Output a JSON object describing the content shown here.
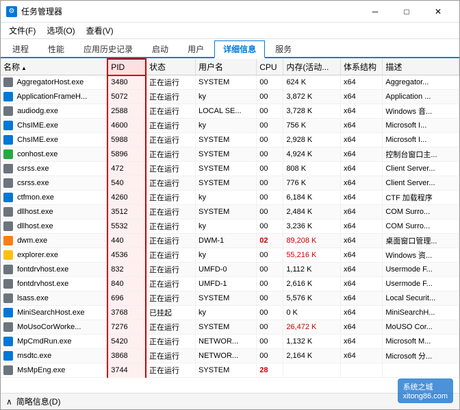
{
  "window": {
    "title": "任务管理器",
    "icon": "⚙"
  },
  "titlebar": {
    "minimize_label": "─",
    "maximize_label": "□",
    "close_label": "✕"
  },
  "menu": {
    "items": [
      "文件(F)",
      "选项(O)",
      "查看(V)"
    ]
  },
  "tabs": [
    {
      "label": "进程",
      "active": false
    },
    {
      "label": "性能",
      "active": false
    },
    {
      "label": "应用历史记录",
      "active": false
    },
    {
      "label": "启动",
      "active": false
    },
    {
      "label": "用户",
      "active": false
    },
    {
      "label": "详细信息",
      "active": true
    },
    {
      "label": "服务",
      "active": false
    }
  ],
  "table": {
    "columns": [
      "名称",
      "PID",
      "状态",
      "用户名",
      "CPU",
      "内存(活动...",
      "体系结构",
      "描述"
    ],
    "sort_col": "名称",
    "sort_dir": "asc",
    "rows": [
      {
        "icon": "gray",
        "name": "AggregatorHost.exe",
        "pid": "3480",
        "status": "正在运行",
        "user": "SYSTEM",
        "cpu": "00",
        "mem": "624 K",
        "arch": "x64",
        "desc": "Aggregator..."
      },
      {
        "icon": "blue",
        "name": "ApplicationFrameH...",
        "pid": "5072",
        "status": "正在运行",
        "user": "ky",
        "cpu": "00",
        "mem": "3,872 K",
        "arch": "x64",
        "desc": "Application ..."
      },
      {
        "icon": "gray",
        "name": "audiodg.exe",
        "pid": "2588",
        "status": "正在运行",
        "user": "LOCAL SE...",
        "cpu": "00",
        "mem": "3,728 K",
        "arch": "x64",
        "desc": "Windows 音..."
      },
      {
        "icon": "blue",
        "name": "ChsIME.exe",
        "pid": "4600",
        "status": "正在运行",
        "user": "ky",
        "cpu": "00",
        "mem": "756 K",
        "arch": "x64",
        "desc": "Microsoft I..."
      },
      {
        "icon": "blue",
        "name": "ChsIME.exe",
        "pid": "5988",
        "status": "正在运行",
        "user": "SYSTEM",
        "cpu": "00",
        "mem": "2,928 K",
        "arch": "x64",
        "desc": "Microsoft I..."
      },
      {
        "icon": "green",
        "name": "conhost.exe",
        "pid": "5896",
        "status": "正在运行",
        "user": "SYSTEM",
        "cpu": "00",
        "mem": "4,924 K",
        "arch": "x64",
        "desc": "控制台窗口主..."
      },
      {
        "icon": "gray",
        "name": "csrss.exe",
        "pid": "472",
        "status": "正在运行",
        "user": "SYSTEM",
        "cpu": "00",
        "mem": "808 K",
        "arch": "x64",
        "desc": "Client Server..."
      },
      {
        "icon": "gray",
        "name": "csrss.exe",
        "pid": "540",
        "status": "正在运行",
        "user": "SYSTEM",
        "cpu": "00",
        "mem": "776 K",
        "arch": "x64",
        "desc": "Client Server..."
      },
      {
        "icon": "blue",
        "name": "ctfmon.exe",
        "pid": "4260",
        "status": "正在运行",
        "user": "ky",
        "cpu": "00",
        "mem": "6,184 K",
        "arch": "x64",
        "desc": "CTF 加载程序"
      },
      {
        "icon": "gray",
        "name": "dllhost.exe",
        "pid": "3512",
        "status": "正在运行",
        "user": "SYSTEM",
        "cpu": "00",
        "mem": "2,484 K",
        "arch": "x64",
        "desc": "COM Surro..."
      },
      {
        "icon": "gray",
        "name": "dllhost.exe",
        "pid": "5532",
        "status": "正在运行",
        "user": "ky",
        "cpu": "00",
        "mem": "3,236 K",
        "arch": "x64",
        "desc": "COM Surro..."
      },
      {
        "icon": "orange",
        "name": "dwm.exe",
        "pid": "440",
        "status": "正在运行",
        "user": "DWM-1",
        "cpu": "02",
        "mem": "89,208 K",
        "arch": "x64",
        "desc": "桌面窗口管理..."
      },
      {
        "icon": "yellow",
        "name": "explorer.exe",
        "pid": "4536",
        "status": "正在运行",
        "user": "ky",
        "cpu": "00",
        "mem": "55,216 K",
        "arch": "x64",
        "desc": "Windows 资..."
      },
      {
        "icon": "gray",
        "name": "fontdrvhost.exe",
        "pid": "832",
        "status": "正在运行",
        "user": "UMFD-0",
        "cpu": "00",
        "mem": "1,112 K",
        "arch": "x64",
        "desc": "Usermode F..."
      },
      {
        "icon": "gray",
        "name": "fontdrvhost.exe",
        "pid": "840",
        "status": "正在运行",
        "user": "UMFD-1",
        "cpu": "00",
        "mem": "2,616 K",
        "arch": "x64",
        "desc": "Usermode F..."
      },
      {
        "icon": "gray",
        "name": "lsass.exe",
        "pid": "696",
        "status": "正在运行",
        "user": "SYSTEM",
        "cpu": "00",
        "mem": "5,576 K",
        "arch": "x64",
        "desc": "Local Securit..."
      },
      {
        "icon": "blue",
        "name": "MiniSearchHost.exe",
        "pid": "3768",
        "status": "已挂起",
        "user": "ky",
        "cpu": "00",
        "mem": "0 K",
        "arch": "x64",
        "desc": "MiniSearchH..."
      },
      {
        "icon": "gray",
        "name": "MoUsoCorWorke...",
        "pid": "7276",
        "status": "正在运行",
        "user": "SYSTEM",
        "cpu": "00",
        "mem": "26,472 K",
        "arch": "x64",
        "desc": "MoUSO Cor..."
      },
      {
        "icon": "blue",
        "name": "MpCmdRun.exe",
        "pid": "5420",
        "status": "正在运行",
        "user": "NETWOR...",
        "cpu": "00",
        "mem": "1,132 K",
        "arch": "x64",
        "desc": "Microsoft M..."
      },
      {
        "icon": "blue",
        "name": "msdtc.exe",
        "pid": "3868",
        "status": "正在运行",
        "user": "NETWOR...",
        "cpu": "00",
        "mem": "2,164 K",
        "arch": "x64",
        "desc": "Microsoft 分..."
      },
      {
        "icon": "gray",
        "name": "MsMpEng.exe",
        "pid": "3744",
        "status": "正在运行",
        "user": "SYSTEM",
        "cpu": "28",
        "mem": "",
        "arch": "",
        "desc": ""
      }
    ]
  },
  "statusbar": {
    "label": "简略信息(D)",
    "arrow": "∧"
  },
  "watermark": {
    "line1": "系统之城",
    "line2": "xitong86.com"
  }
}
